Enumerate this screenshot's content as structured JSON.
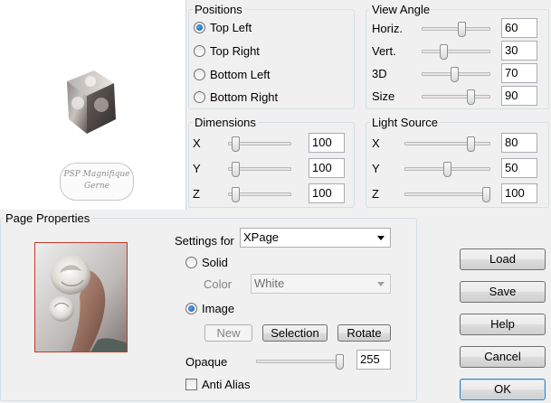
{
  "watermark": {
    "line1": "PSP Magnifique",
    "line2": "Gerne"
  },
  "positions": {
    "title": "Positions",
    "options": [
      {
        "label": "Top Left",
        "selected": true
      },
      {
        "label": "Top Right",
        "selected": false
      },
      {
        "label": "Bottom Left",
        "selected": false
      },
      {
        "label": "Bottom Right",
        "selected": false
      }
    ]
  },
  "view_angle": {
    "title": "View Angle",
    "sliders": [
      {
        "label": "Horiz.",
        "value": "60",
        "fraction": 0.6
      },
      {
        "label": "Vert.",
        "value": "30",
        "fraction": 0.3
      },
      {
        "label": "3D",
        "value": "70",
        "fraction": 0.48
      },
      {
        "label": "Size",
        "value": "90",
        "fraction": 0.74
      }
    ]
  },
  "dimensions": {
    "title": "Dimensions",
    "sliders": [
      {
        "label": "X",
        "value": "100",
        "fraction": 0.06
      },
      {
        "label": "Y",
        "value": "100",
        "fraction": 0.06
      },
      {
        "label": "Z",
        "value": "100",
        "fraction": 0.06
      }
    ]
  },
  "light_source": {
    "title": "Light Source",
    "sliders": [
      {
        "label": "X",
        "value": "80",
        "fraction": 0.8
      },
      {
        "label": "Y",
        "value": "50",
        "fraction": 0.5
      },
      {
        "label": "Z",
        "value": "100",
        "fraction": 1.0
      }
    ]
  },
  "page_properties": {
    "title": "Page Properties",
    "settings_for_label": "Settings for",
    "settings_for_value": "XPage",
    "solid_label": "Solid",
    "solid_selected": false,
    "color_label": "Color",
    "color_value": "White",
    "image_label": "Image",
    "image_selected": true,
    "new_label": "New",
    "selection_label": "Selection",
    "rotate_label": "Rotate",
    "opaque_label": "Opaque",
    "opaque_value": "255",
    "opaque_fraction": 1.0,
    "anti_alias_label": "Anti Alias",
    "anti_alias_checked": false
  },
  "buttons": {
    "load": "Load",
    "save": "Save",
    "help": "Help",
    "cancel": "Cancel",
    "ok": "OK"
  }
}
